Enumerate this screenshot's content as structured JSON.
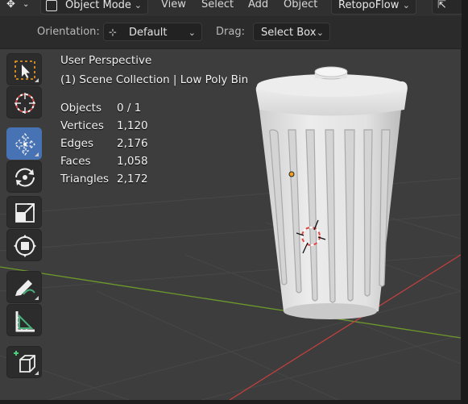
{
  "header": {
    "editor_icon": "3d-viewport-icon",
    "mode_label": "Object Mode",
    "menus": [
      "View",
      "Select",
      "Add",
      "Object"
    ],
    "addon_label": "RetopoFlow"
  },
  "tool_settings": {
    "orientation_label": "Orientation:",
    "orientation_value": "Default",
    "drag_label": "Drag:",
    "drag_value": "Select Box"
  },
  "overlay": {
    "view_name": "User Perspective",
    "collection_line": "(1) Scene Collection | Low Poly Bin",
    "stats": [
      {
        "label": "Objects",
        "value": "0 / 1"
      },
      {
        "label": "Vertices",
        "value": "1,120"
      },
      {
        "label": "Edges",
        "value": "2,176"
      },
      {
        "label": "Faces",
        "value": "1,058"
      },
      {
        "label": "Triangles",
        "value": "2,172"
      }
    ]
  },
  "toolbar": {
    "tools": [
      {
        "name": "select-box-tool",
        "icon": "select-box-icon",
        "active": false
      },
      {
        "name": "cursor-tool",
        "icon": "cursor-icon",
        "active": false
      },
      {
        "name": "move-tool",
        "icon": "move-icon",
        "active": true
      },
      {
        "name": "rotate-tool",
        "icon": "rotate-icon",
        "active": false
      },
      {
        "name": "scale-tool",
        "icon": "scale-icon",
        "active": false
      },
      {
        "name": "transform-tool",
        "icon": "transform-icon",
        "active": false
      },
      {
        "name": "annotate-tool",
        "icon": "annotate-icon",
        "active": false
      },
      {
        "name": "measure-tool",
        "icon": "measure-icon",
        "active": false
      },
      {
        "name": "add-cube-tool",
        "icon": "add-cube-icon",
        "active": false
      }
    ]
  },
  "colors": {
    "accent": "#4772b3",
    "viewport_bg": "#3d3d3d",
    "x_axis": "#c0403f",
    "y_axis": "#6d9a2b",
    "origin_dot": "#f0a020"
  }
}
